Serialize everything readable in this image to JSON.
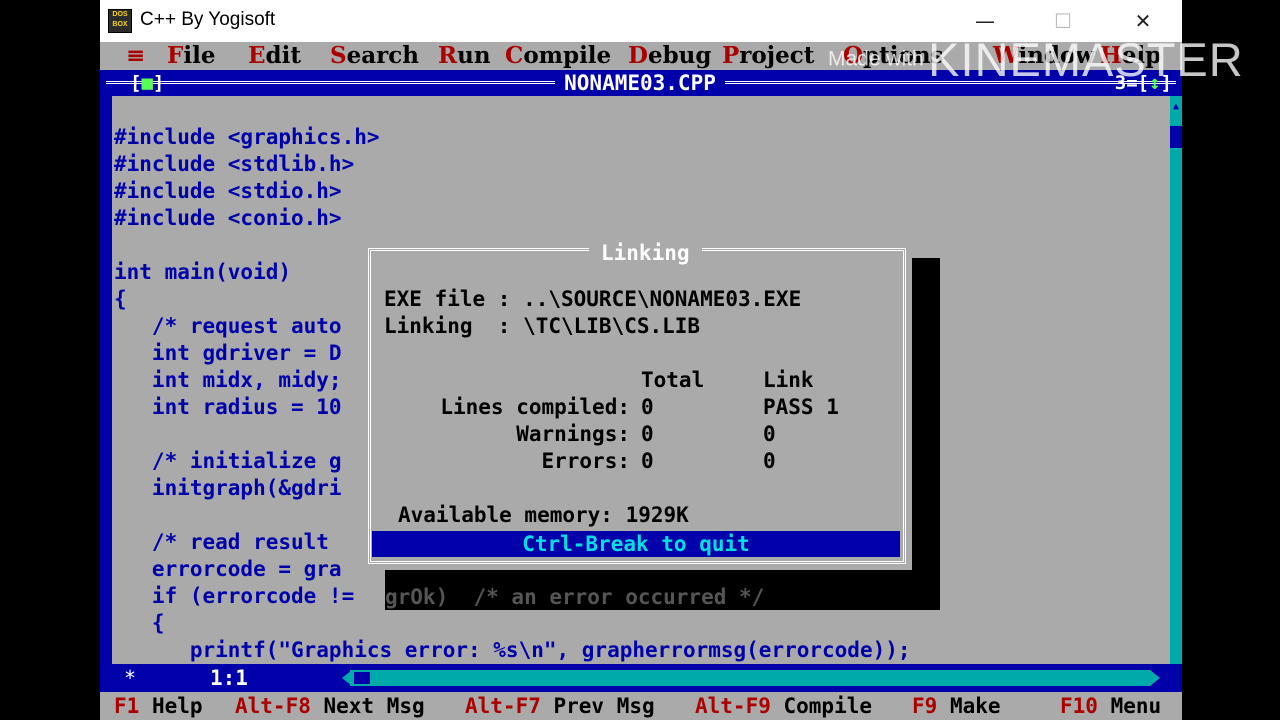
{
  "window": {
    "title": "C++ By Yogisoft",
    "icon_text_top": "DOS",
    "icon_text_bottom": "BOX",
    "minimize": "—",
    "maximize": "☐",
    "close": "✕"
  },
  "menu": {
    "system": "≡",
    "items": [
      {
        "hot": "F",
        "rest": "ile"
      },
      {
        "hot": "E",
        "rest": "dit"
      },
      {
        "hot": "S",
        "rest": "earch"
      },
      {
        "hot": "R",
        "rest": "un"
      },
      {
        "hot": "C",
        "rest": "ompile"
      },
      {
        "hot": "D",
        "rest": "ebug"
      },
      {
        "hot": "P",
        "rest": "roject"
      },
      {
        "hot": "O",
        "rest": "ptions"
      },
      {
        "hot": "W",
        "rest": "indow"
      },
      {
        "hot": "H",
        "rest": "elp"
      }
    ]
  },
  "editor": {
    "filename": "NONAME03.CPP",
    "close_box_left": "[",
    "close_box_mid": "■",
    "close_box_right": "]",
    "window_number": "3=[",
    "zoom_icon": "↕",
    "window_number_end": "]",
    "cursor_pos": "1:1",
    "modified_star": "*",
    "code": [
      "#include <graphics.h>",
      "#include <stdlib.h>",
      "#include <stdio.h>",
      "#include <conio.h>",
      "",
      "int main(void)",
      "{",
      "   /* request auto",
      "   int gdriver = D",
      "   int midx, midy;",
      "   int radius = 10",
      "",
      "   /* initialize g",
      "   initgraph(&gdri",
      "",
      "   /* read result",
      "   errorcode = gra",
      "   if (errorcode !=",
      "   {",
      "      printf(\"Graphics error: %s\\n\", grapherrormsg(errorcode));"
    ]
  },
  "dialog": {
    "title": "Linking",
    "exe_label": "EXE file : ..\\SOURCE\\NONAME03.EXE",
    "linking_label": "Linking  : \\TC\\LIB\\CS.LIB",
    "header_total": "Total",
    "header_link": "Link",
    "rows": [
      {
        "label": "Lines compiled:",
        "total": "0",
        "link": "PASS 1"
      },
      {
        "label": "Warnings:",
        "total": "0",
        "link": "0"
      },
      {
        "label": "Errors:",
        "total": "0",
        "link": "0"
      }
    ],
    "memory": "Available memory: 1929K",
    "quit": "Ctrl-Break to quit",
    "behind_text": "grOk)  /* an error occurred */"
  },
  "statusbar": [
    {
      "key": "F1",
      "label": " Help"
    },
    {
      "key": "Alt-F8",
      "label": " Next Msg"
    },
    {
      "key": "Alt-F7",
      "label": " Prev Msg"
    },
    {
      "key": "Alt-F9",
      "label": " Compile"
    },
    {
      "key": "F9",
      "label": " Make"
    },
    {
      "key": "F10",
      "label": " Menu"
    }
  ],
  "watermark": {
    "small": "Made with",
    "big": "KINEMASTER"
  },
  "colors": {
    "dos_blue": "#0000aa",
    "dos_gray": "#aaaaaa",
    "dos_cyan": "#00aaaa",
    "hotkey_red": "#aa0000"
  }
}
